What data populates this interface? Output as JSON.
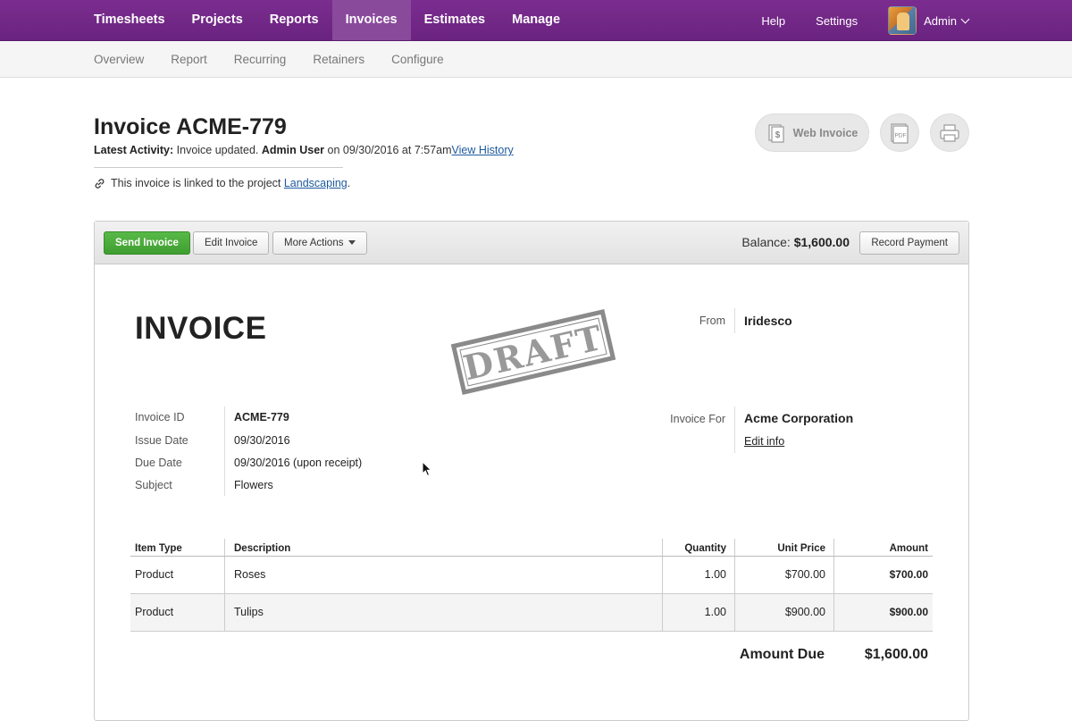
{
  "topnav": {
    "items": [
      "Timesheets",
      "Projects",
      "Reports",
      "Invoices",
      "Estimates",
      "Manage"
    ],
    "active": "Invoices",
    "help": "Help",
    "settings": "Settings",
    "user": "Admin",
    "bg_color": "#6e2683"
  },
  "subnav": {
    "items": [
      "Overview",
      "Report",
      "Recurring",
      "Retainers",
      "Configure"
    ]
  },
  "header": {
    "title": "Invoice ACME-779",
    "activity_label": "Latest Activity:",
    "activity_text": "Invoice updated.",
    "activity_user": "Admin User",
    "activity_when": "on 09/30/2016 at 7:57am",
    "view_history": "View History",
    "linked_prefix": "This invoice is linked to the project",
    "linked_project": "Landscaping",
    "linked_suffix": ".",
    "web_invoice": "Web Invoice",
    "pdf_label": "PDF"
  },
  "toolbar": {
    "send": "Send Invoice",
    "edit": "Edit Invoice",
    "more": "More Actions",
    "balance_label": "Balance:",
    "balance_value": "$1,600.00",
    "record": "Record Payment",
    "send_color": "#4aab3b"
  },
  "invoice": {
    "heading": "INVOICE",
    "stamp": "DRAFT",
    "from_label": "From",
    "from_value": "Iridesco",
    "for_label": "Invoice For",
    "for_value": "Acme Corporation",
    "edit_info": "Edit info",
    "fields": [
      {
        "label": "Invoice ID",
        "value": "ACME-779"
      },
      {
        "label": "Issue Date",
        "value": "09/30/2016"
      },
      {
        "label": "Due Date",
        "value": "09/30/2016 (upon receipt)"
      },
      {
        "label": "Subject",
        "value": "Flowers"
      }
    ],
    "columns": [
      "Item Type",
      "Description",
      "Quantity",
      "Unit Price",
      "Amount"
    ],
    "rows": [
      [
        "Product",
        "Roses",
        "1.00",
        "$700.00",
        "$700.00"
      ],
      [
        "Product",
        "Tulips",
        "1.00",
        "$900.00",
        "$900.00"
      ]
    ],
    "amount_due_label": "Amount Due",
    "amount_due_value": "$1,600.00"
  }
}
